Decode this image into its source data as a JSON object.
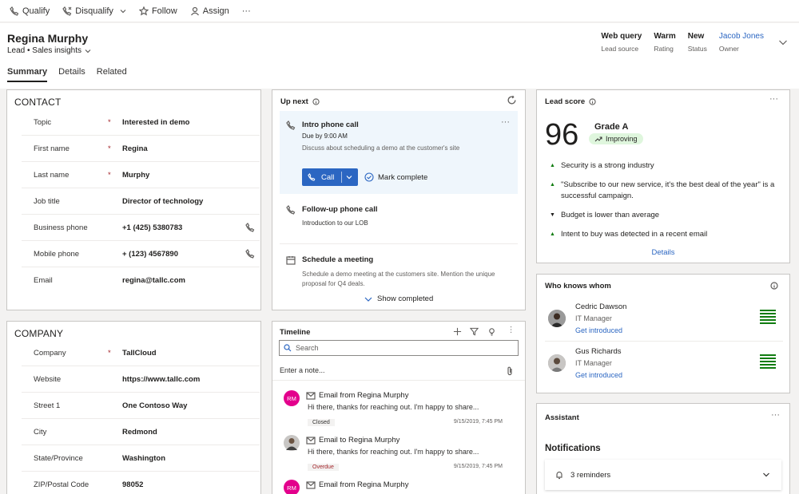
{
  "commands": [
    {
      "label": "Qualify",
      "icon": "phone-check-icon"
    },
    {
      "label": "Disqualify",
      "icon": "phone-cancel-icon",
      "has_dropdown": true
    },
    {
      "label": "Follow",
      "icon": "star-icon"
    },
    {
      "label": "Assign",
      "icon": "person-icon"
    },
    {
      "label": "···",
      "icon": "more-icon"
    }
  ],
  "record": {
    "name": "Regina Murphy",
    "subtitle": "Lead • Sales insights",
    "header_fields": [
      {
        "value": "Web query",
        "label": "Lead source"
      },
      {
        "value": "Warm",
        "label": "Rating"
      },
      {
        "value": "New",
        "label": "Status"
      },
      {
        "value": "Jacob Jones",
        "label": "Owner"
      }
    ]
  },
  "tabs": [
    "Summary",
    "Details",
    "Related"
  ],
  "contact": {
    "title": "CONTACT",
    "fields": [
      {
        "label": "Topic",
        "required": "*",
        "value": "Interested in demo"
      },
      {
        "label": "First name",
        "required": "*",
        "value": "Regina"
      },
      {
        "label": "Last name",
        "required": "*",
        "value": "Murphy"
      },
      {
        "label": "Job title",
        "required": "",
        "value": "Director of technology"
      },
      {
        "label": "Business phone",
        "required": "",
        "value": "+1 (425) 5380783"
      },
      {
        "label": "Mobile phone",
        "required": "",
        "value": "+ (123) 4567890"
      },
      {
        "label": "Email",
        "required": "",
        "value": "regina@tallc.com"
      }
    ]
  },
  "company": {
    "title": "COMPANY",
    "fields": [
      {
        "label": "Company",
        "required": "*",
        "value": "TallCloud"
      },
      {
        "label": "Website",
        "required": "",
        "value": "https://www.tallc.com"
      },
      {
        "label": "Street 1",
        "required": "",
        "value": "One Contoso Way"
      },
      {
        "label": "City",
        "required": "",
        "value": "Redmond"
      },
      {
        "label": "State/Province",
        "required": "",
        "value": "Washington"
      },
      {
        "label": "ZIP/Postal Code",
        "required": "",
        "value": "98052"
      }
    ]
  },
  "up_next": {
    "title": "Up next",
    "items": [
      {
        "title": "Intro phone call",
        "sub": "Due by 9:00 AM",
        "desc": "Discuss about scheduling a demo at the customer's site",
        "icon": "phone-icon"
      },
      {
        "title": "Follow-up phone call",
        "sub": "Introduction to our LOB",
        "desc": "",
        "icon": "phone-icon"
      },
      {
        "title": "Schedule a meeting",
        "sub": "",
        "desc_lines": [
          "Schedule a demo meeting at the customers site. Mention the unique",
          "proposal for Q4 deals."
        ],
        "icon": "calendar-icon"
      }
    ],
    "call_label": "Call",
    "mark_complete": "Mark complete",
    "more": "···",
    "show_completed": "Show completed"
  },
  "timeline": {
    "title": "Timeline",
    "search_placeholder": "Search",
    "note_placeholder": "Enter a note...",
    "items": [
      {
        "avatar": "RM",
        "avatar_color": "#e3008c",
        "title": "Email from Regina Murphy",
        "body": "Hi there, thanks for reaching out. I'm happy to share...",
        "badge": "Closed",
        "badge_color": "#323130",
        "date": "9/15/2019, 7:45 PM"
      },
      {
        "avatar": "",
        "avatar_color": "#8a8886",
        "title": "Email to Regina Murphy",
        "body": "Hi there, thanks for reaching out. I'm happy to share...",
        "badge": "Overdue",
        "badge_color": "#a4262c",
        "date": "9/15/2019, 7:45 PM"
      },
      {
        "avatar": "RM",
        "avatar_color": "#e3008c",
        "title": "Email from Regina Murphy",
        "body": "",
        "badge": "",
        "date": ""
      }
    ]
  },
  "lead_score": {
    "title": "Lead score",
    "score": "96",
    "grade": "Grade A",
    "trend": "Improving",
    "insights": [
      {
        "dir": "up",
        "text_lines": [
          "Security is a strong industry"
        ]
      },
      {
        "dir": "up",
        "text_lines": [
          "\"Subscribe to our new service, it's the best deal of the year\" is a",
          "successful campaign."
        ]
      },
      {
        "dir": "down",
        "text_lines": [
          "Budget is lower than average"
        ]
      },
      {
        "dir": "up",
        "text_lines": [
          "Intent to buy was detected in a recent email"
        ]
      }
    ],
    "details_link": "Details"
  },
  "who_knows_whom": {
    "title": "Who knows whom",
    "people": [
      {
        "name": "Cedric Dawson",
        "role": "IT Manager",
        "action": "Get introduced"
      },
      {
        "name": "Gus Richards",
        "role": "IT Manager",
        "action": "Get introduced"
      }
    ]
  },
  "assistant": {
    "title": "Assistant",
    "notifications": "Notifications",
    "reminders": "3 reminders"
  },
  "colors": {
    "accent": "#2b66c2",
    "improving_bg": "#dff6dd",
    "up_green": "#107c10",
    "strength_green": "#107c10"
  }
}
